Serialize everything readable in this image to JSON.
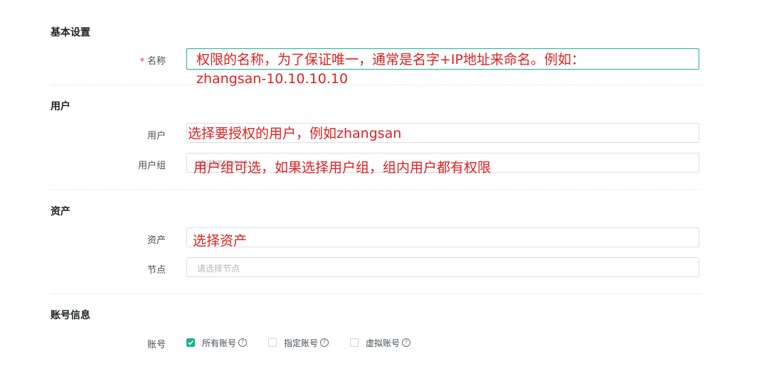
{
  "basic": {
    "title": "基本设置",
    "name_label": "名称",
    "name_required": "*",
    "name_note_line1": "权限的名称，为了保证唯一，通常是名字+IP地址来命名。例如：",
    "name_note_line2": "zhangsan-10.10.10.10"
  },
  "user": {
    "title": "用户",
    "user_label": "用户",
    "user_note": "选择要授权的用户，例如zhangsan",
    "group_label": "用户组",
    "group_placeholder": "请选择用户组",
    "group_note": "用户组可选，如果选择用户组，组内用户都有权限"
  },
  "asset": {
    "title": "资产",
    "asset_label": "资产",
    "asset_note": "选择资产",
    "node_label": "节点",
    "node_placeholder": "请选择节点"
  },
  "account": {
    "title": "账号信息",
    "label": "账号",
    "options": [
      {
        "label": "所有账号",
        "checked": true
      },
      {
        "label": "指定账号",
        "checked": false
      },
      {
        "label": "虚拟账号",
        "checked": false
      }
    ],
    "help_glyph": "?"
  },
  "colors": {
    "accent": "#1ab394",
    "annotation": "#e02020"
  }
}
